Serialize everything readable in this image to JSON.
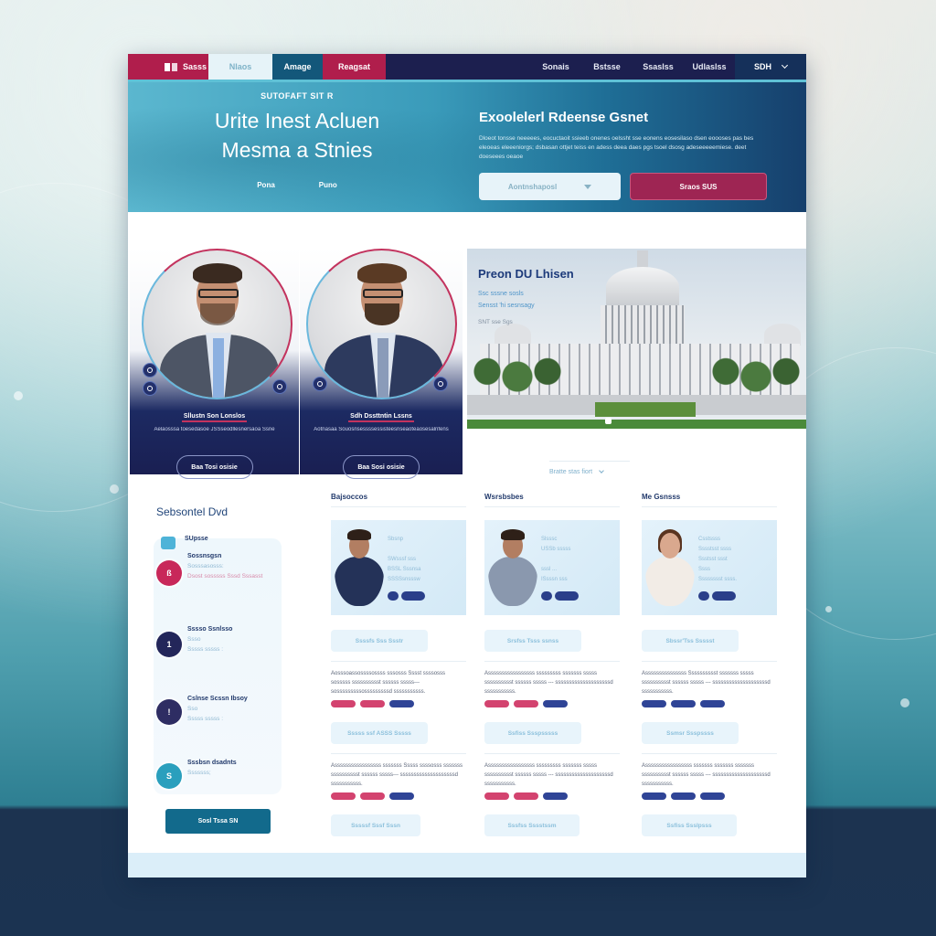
{
  "nav": {
    "logo": "NB",
    "left_tabs": [
      "Sasss",
      "Nlaos",
      "Amage",
      "Reagsat"
    ],
    "right_tabs": [
      "Sonais",
      "Bstsse",
      "Ssaslss",
      "Udlaslss"
    ],
    "account_menu": "SDH"
  },
  "hero": {
    "eyebrow": "SUTOFAFT SIT R",
    "title_line1": "Urite Inest Acluen",
    "title_line2": "Mesma a Stnies",
    "links": [
      "Pona",
      "Puno"
    ],
    "right_title": "Exoolelerl Rdeense Gsnet",
    "description": "Dloeot tonsse neeeees, eocuctaoit ssieeb onenes oelssht sse eonens eosesilaso dsen eoooses pas bes eleoeas eleeeniorgs; dsbasan ottjet  teiss en adess deea daes pgs tsoel dsosg adeseeeeemiese. deet doeseees oeaoe",
    "select_value": "Aontnshaposl",
    "cta_label": "Sraos SUS"
  },
  "profiles": [
    {
      "name": "Sllustn Son Lonslos",
      "description": "Aelaosssa toesedasoe JSSseodllesnersaoa Ssne",
      "button": "Baa Tosi osisie"
    },
    {
      "name": "Sdh Dssttntin Lssns",
      "description": "Aotnasaa Souosnsessssessisteesnseaoteaosesalnfens",
      "button": "Baa Sosi osisie"
    }
  ],
  "feature": {
    "title": "Preon DU Lhisen",
    "sub_line1": "Ssc sssne sosls",
    "sub_line2": "Sensst 'hi sesnsagy",
    "meta": "SNT sse Sgs",
    "more_link": "Bratte stas fiort"
  },
  "sidebar": {
    "title": "Sebsontel Dvd",
    "top_label": "SUpsse",
    "items": [
      {
        "title": "Sossnsgsn",
        "line1": "Sosssasosss:",
        "line2": "Dsost sosssss Sssd Sssasst",
        "icon": "ß"
      },
      {
        "title": "Sssso Ssnlsso",
        "line1": "Ssso",
        "line2": "Sssss sssss :",
        "icon": "1"
      },
      {
        "title": "Cslnse Scssn Ibsoy",
        "line1": "Sso",
        "line2": "Sssss sssss :",
        "icon": "!"
      },
      {
        "title": "Sssbsn dsadnts",
        "line1": "Sssssss;",
        "line2": "",
        "icon": "S"
      }
    ],
    "button": "Sosl Tssa SN"
  },
  "columns": [
    {
      "title": "Bajsoccos",
      "card_lines": [
        "Sbsnp",
        "",
        "SWsssf sss",
        "BSSL Sssnsa",
        "SSSSsnsssw"
      ],
      "ghost_button": "Ssssfs Sss Ssstr",
      "blurbs": [
        {
          "text": "Aosssoassossssossss sssosss Sssst ssssosss sosssss sssssssssst ssssss sssss--- sosssssssssosssssssssd sssssssssss.",
          "tags": [
            "pink",
            "pink",
            "navy"
          ]
        },
        {
          "text": "Asssssssssssssssss sssssss Sssss ssssosss sssssss sssssssssst ssssss sssss--- ssssssssssssssssssssd sssssssssss.",
          "tags": [
            "pink",
            "pink",
            "navy"
          ]
        }
      ],
      "buttons": [
        "Sssss ssf ASSS Sssss",
        "Sssssf Sssf Sssn"
      ]
    },
    {
      "title": "Wsrsbsbes",
      "card_lines": [
        "Slsssc",
        "USSb sssss",
        "",
        "sssl ...",
        "ISsssn sss"
      ],
      "ghost_button": "Srsfss Tsss ssnss",
      "blurbs": [
        {
          "text": "Asssssssssssssssss sssssssss sssssss sssss sssssssssst ssssss sssss --- ssssssssssssssssssssd sssssssssss.",
          "tags": [
            "pink",
            "pink",
            "navy"
          ]
        },
        {
          "text": "Asssssssssssssssss sssssssss sssssss sssss sssssssssst ssssss sssss --- ssssssssssssssssssssd sssssssssss.",
          "tags": [
            "pink",
            "pink",
            "navy"
          ]
        }
      ],
      "buttons": [
        "Ssfiss Ssspsssss",
        "Sssfss Sssstssm"
      ]
    },
    {
      "title": "Me Gsnsss",
      "card_lines": [
        "Csstssss",
        "Sssstsst ssss",
        "Ssstsst ssst",
        "Ssss",
        "Sssssssst ssss."
      ],
      "ghost_button": "Sbssr'Tss Ssssst",
      "blurbs": [
        {
          "text": "Asssssssssssssss Sssssssssst sssssss sssss sssssssssst ssssss sssss --- ssssssssssssssssssssd sssssssssss.",
          "tags": [
            "navy",
            "navy",
            "navy"
          ]
        },
        {
          "text": "Asssssssssssssssss sssssss sssssss sssssss sssssssssst ssssss sssss --- ssssssssssssssssssssd sssssssssss.",
          "tags": [
            "navy",
            "navy",
            "navy"
          ]
        }
      ],
      "buttons": [
        "Ssmsr Ssspssss",
        "Ssfiss Ssslpsss"
      ]
    }
  ]
}
